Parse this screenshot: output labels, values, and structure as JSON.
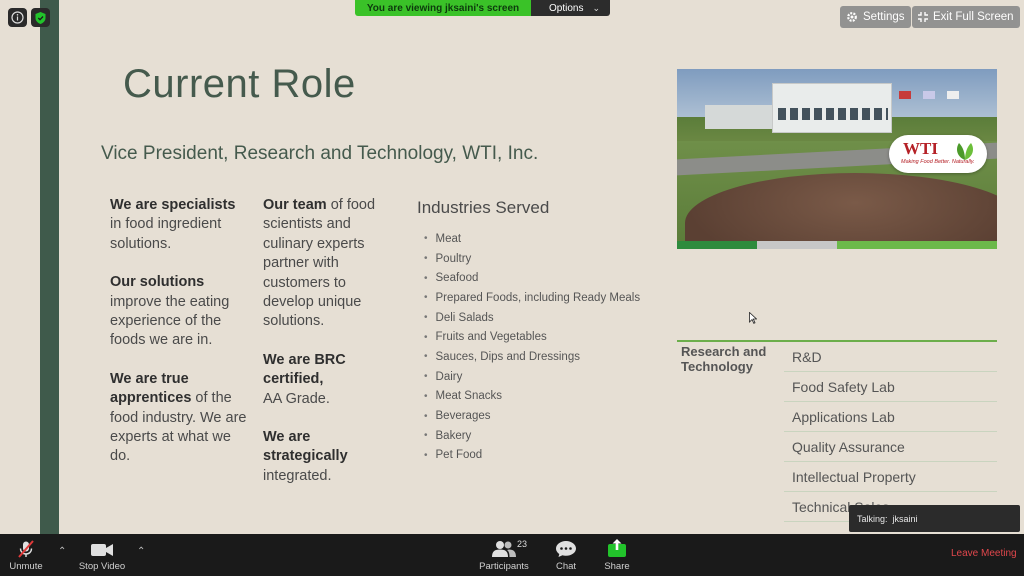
{
  "meeting": {
    "viewing_banner": "You are viewing jksaini's screen",
    "options_label": "Options",
    "settings_label": "Settings",
    "exit_fullscreen_label": "Exit Full Screen",
    "talking_label": "Talking:",
    "talking_name": "jksaini"
  },
  "slide": {
    "title": "Current Role",
    "subtitle": "Vice President, Research and Technology, WTI, Inc.",
    "col1": [
      {
        "bold": "We are specialists",
        "rest": " in food ingredient solutions."
      },
      {
        "bold": "Our solutions",
        "rest": " improve the eating experience of the foods we are in."
      },
      {
        "bold": "We are true apprentices",
        "rest": " of the food industry. We are experts at what we do."
      }
    ],
    "col2": [
      {
        "bold": "Our team",
        "rest": " of food scientists and culinary experts partner with customers to develop unique solutions."
      },
      {
        "bold": "We are BRC certified,",
        "rest": " AA Grade."
      },
      {
        "bold": "We are strategically",
        "rest": " integrated."
      }
    ],
    "industries_title": "Industries Served",
    "industries": [
      "Meat",
      "Poultry",
      "Seafood",
      "Prepared Foods, including Ready Meals",
      "Deli Salads",
      "Fruits and Vegetables",
      "Sauces, Dips and Dressings",
      "Dairy",
      "Meat Snacks",
      "Beverages",
      "Bakery",
      "Pet Food"
    ],
    "logo": {
      "name": "WTI",
      "tagline": "Making Food Better. Naturally."
    },
    "rd_heading": "Research and Technology",
    "rd_items": [
      "R&D",
      "Food Safety Lab",
      "Applications Lab",
      "Quality Assurance",
      "Intellectual Property",
      "Technical Sales"
    ]
  },
  "toolbar": {
    "unmute": "Unmute",
    "stop_video": "Stop Video",
    "participants": "Participants",
    "participants_count": "23",
    "chat": "Chat",
    "share": "Share",
    "leave": "Leave Meeting"
  },
  "colors": {
    "accent_green": "#3ac228",
    "slide_green": "#455a4d",
    "leave_red": "#e0474c",
    "share_green": "#22c32b"
  }
}
